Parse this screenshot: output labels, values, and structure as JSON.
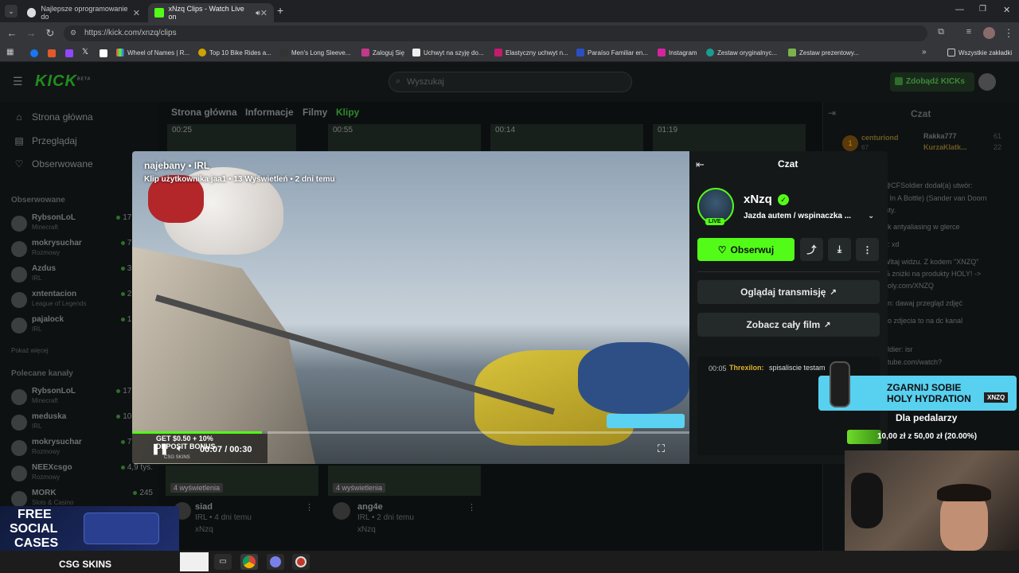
{
  "browser": {
    "tabs": [
      {
        "title": "Najlepsze oprogramowanie do",
        "active": false
      },
      {
        "title": "xNzq Clips - Watch Live on",
        "active": true
      }
    ],
    "url": "https://kick.com/xnzq/clips",
    "bookmarks": [
      "Wheel of Names | R...",
      "Top 10 Bike Rides a...",
      "Men's Long Sleeve...",
      "Zaloguj Się",
      "Uchwyt na szyję do...",
      "Elastyczny uchwyt n...",
      "Paraíso Familiar en...",
      "Instagram",
      "Zestaw oryginalnyc...",
      "Zestaw prezentowy..."
    ],
    "all_bookmarks": "Wszystkie zakładki"
  },
  "site": {
    "logo": "KICK",
    "logo_sup": "BETA",
    "search_placeholder": "Wyszukaj",
    "get_kicks": "Zdobądź KICKs"
  },
  "sidebar": {
    "nav": [
      {
        "label": "Strona główna",
        "icon": "home-icon"
      },
      {
        "label": "Przeglądaj",
        "icon": "browse-icon"
      },
      {
        "label": "Obserwowane",
        "icon": "heart-icon"
      }
    ],
    "followed_title": "Obserwowane",
    "followed": [
      {
        "name": "RybsonLoL",
        "category": "Minecraft",
        "viewers": "17,3 tys."
      },
      {
        "name": "mokrysuchar",
        "category": "Rozmowy",
        "viewers": "7,1 tys."
      },
      {
        "name": "Azdus",
        "category": "IRL",
        "viewers": "3,2 tys."
      },
      {
        "name": "xntentacion",
        "category": "League of Legends",
        "viewers": "2,8 tys."
      },
      {
        "name": "pajalock",
        "category": "IRL",
        "viewers": "1,4 tys."
      }
    ],
    "show_more": "Pokaż więcej",
    "recommended_title": "Polecane kanały",
    "recommended": [
      {
        "name": "RybsonLoL",
        "category": "Minecraft",
        "viewers": "17,5 tys."
      },
      {
        "name": "meduska",
        "category": "IRL",
        "viewers": "10,6 tys."
      },
      {
        "name": "mokrysuchar",
        "category": "Rozmowy",
        "viewers": "7,2 tys."
      },
      {
        "name": "NEEXcsgo",
        "category": "Rozmowy",
        "viewers": "4,9 tys."
      },
      {
        "name": "MORK",
        "category": "Slots & Casino",
        "viewers": "245"
      }
    ]
  },
  "channel_tabs": [
    "Strona główna",
    "Informacje",
    "Filmy",
    "Klipy"
  ],
  "active_channel_tab": "Klipy",
  "clip_durations": [
    "00:25",
    "00:55",
    "00:14",
    "01:19"
  ],
  "bottom_clips": [
    {
      "views": "4 wyświetlenia",
      "title": "siad",
      "meta": "IRL • 4 dni temu",
      "channel": "xNzq"
    },
    {
      "views": "4 wyświetlenia",
      "title": "ang4e",
      "meta": "IRL • 2 dni temu",
      "channel": "xNzq"
    }
  ],
  "bg_chat": {
    "title": "Czat",
    "gifters": [
      {
        "name": "centuriond",
        "count": "67"
      },
      {
        "name": "Rakka777",
        "count": "61"
      },
      {
        "name": "KurzaKlatk...",
        "count": "22"
      }
    ],
    "lines": [
      "@CFSoldier dodał(a) utwór:",
      "e In A Bottle) (Sander van Doorn",
      "isty.",
      "ak antyaliasing w glerce",
      "a: xd",
      "Witaj widzu. Z kodem \"XNZQ\"",
      "% zniżki na produkty HOLY! ->",
      "holy.com/XNZQ",
      "on: dawaj przegląd zdjęć",
      "no zdjecia to na dc kanal",
      "oldier: isr",
      "utube.com/watch?"
    ]
  },
  "modal": {
    "title_line": "najebany • IRL",
    "sub_line": "Klip użytkownika jaa1 • 13 Wyświetleń • 2 dni temu",
    "time": "00:07 / 00:30",
    "progress": 0.233,
    "overlay_promo": "GET $0.50 + 10% DEPOSIT BONUS",
    "overlay_promo_brand": "CSG SKINS",
    "right": {
      "header": "Czat",
      "channel_name": "xNzq",
      "live_badge": "LIVE",
      "stream_title": "Jazda autem / wspinaczka ...",
      "follow_label": "Obserwuj",
      "watch_stream_label": "Oglądaj transmisję",
      "watch_film_label": "Zobacz cały film",
      "chat_time": "00:05",
      "chat_user": "Threxilon:",
      "chat_msg": "spisaliscie testam"
    }
  },
  "promo": {
    "headline1": "ZGARNIJ SOBIE",
    "headline2": "HOLY HYDRATION",
    "code": "XNZQ",
    "for_cyclists": "Dla pedalarzy",
    "progress_text": "10,00 zł z 50,00 zł (20.00%)",
    "progress_value": 0.2
  },
  "ad_bottom_left": {
    "line1": "FREE",
    "line2": "SOCIAL",
    "line3": "CASES",
    "brand": "CSG SKINS"
  },
  "colors": {
    "kick_green": "#53fc18",
    "bg": "#0b0e0f"
  }
}
